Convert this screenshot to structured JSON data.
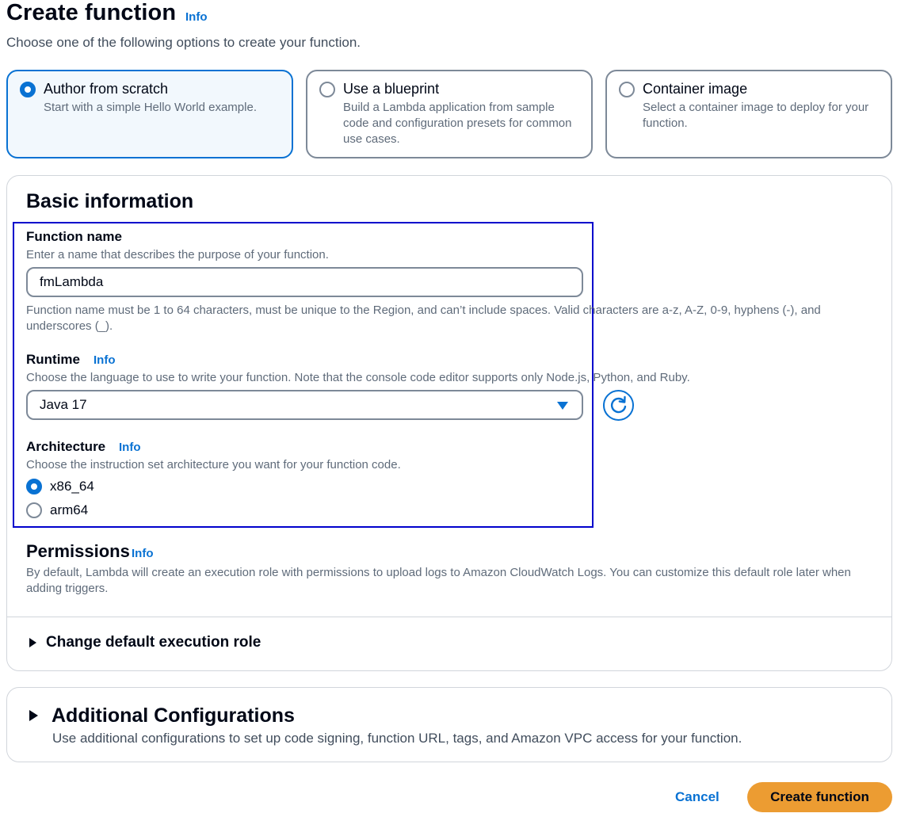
{
  "header": {
    "title": "Create function",
    "info": "Info",
    "subtitle": "Choose one of the following options to create your function."
  },
  "options": [
    {
      "title": "Author from scratch",
      "desc": "Start with a simple Hello World example.",
      "selected": true
    },
    {
      "title": "Use a blueprint",
      "desc": "Build a Lambda application from sample code and configuration presets for common use cases.",
      "selected": false
    },
    {
      "title": "Container image",
      "desc": "Select a container image to deploy for your function.",
      "selected": false
    }
  ],
  "basic": {
    "heading": "Basic information",
    "function_name": {
      "label": "Function name",
      "desc": "Enter a name that describes the purpose of your function.",
      "value": "fmLambda",
      "constraint": "Function name must be 1 to 64 characters, must be unique to the Region, and can’t include spaces. Valid characters are a-z, A-Z, 0-9, hyphens (-), and underscores (_)."
    },
    "runtime": {
      "label": "Runtime",
      "info": "Info",
      "desc": "Choose the language to use to write your function. Note that the console code editor supports only Node.js, Python, and Ruby.",
      "value": "Java 17"
    },
    "architecture": {
      "label": "Architecture",
      "info": "Info",
      "desc": "Choose the instruction set architecture you want for your function code.",
      "options": [
        {
          "label": "x86_64",
          "selected": true
        },
        {
          "label": "arm64",
          "selected": false
        }
      ]
    },
    "permissions": {
      "heading": "Permissions",
      "info": "Info",
      "desc": "By default, Lambda will create an execution role with permissions to upload logs to Amazon CloudWatch Logs. You can customize this default role later when adding triggers."
    },
    "exec_role": "Change default execution role"
  },
  "additional": {
    "heading": "Additional Configurations",
    "desc": "Use additional configurations to set up code signing, function URL, tags, and Amazon VPC access for your function."
  },
  "footer": {
    "cancel": "Cancel",
    "create": "Create function"
  },
  "colors": {
    "accent": "#0972d3",
    "primary_button": "#ec9c32",
    "highlight_border": "#0000cc"
  }
}
